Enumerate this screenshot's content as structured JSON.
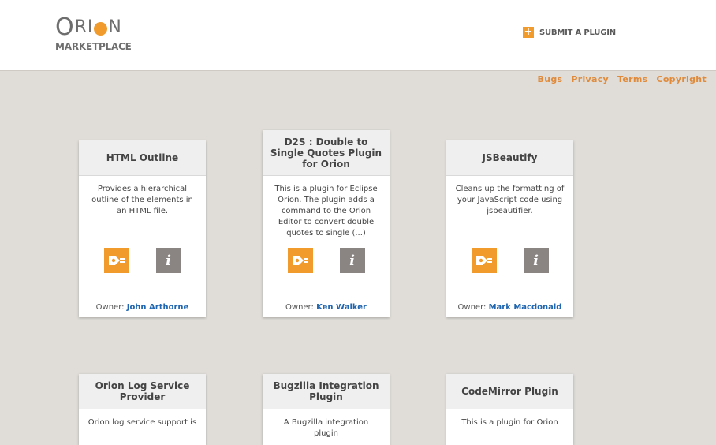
{
  "header": {
    "logo_main_o": "O",
    "logo_main_ri": "RI",
    "logo_main_n": "N",
    "logo_sub": "MARKETPLACE",
    "submit_icon": "plus-icon",
    "submit_label": "SUBMIT A PLUGIN"
  },
  "links": [
    "Bugs",
    "Privacy",
    "Terms",
    "Copyright"
  ],
  "colors": {
    "accent": "#f19b2c",
    "link": "#e08a3a",
    "owner_link": "#2166b0",
    "background": "#e0ddd8"
  },
  "plugins": [
    {
      "title": "HTML Outline",
      "description": "Provides a hierarchical outline of the elements in an HTML file.",
      "owner_label": "Owner:",
      "owner": "John Arthorne"
    },
    {
      "title": "D2S : Double to Single Quotes Plugin for Orion",
      "description": "This is a plugin for Eclipse Orion. The plugin adds a command to the Orion Editor to convert double quotes to single (...)",
      "owner_label": "Owner:",
      "owner": "Ken Walker"
    },
    {
      "title": "JSBeautify",
      "description": "Cleans up the formatting of your JavaScript code using jsbeautifier.",
      "owner_label": "Owner:",
      "owner": "Mark Macdonald"
    },
    {
      "title": "Orion Log Service Provider",
      "description": "Orion log service support is"
    },
    {
      "title": "Bugzilla Integration Plugin",
      "description": "A Bugzilla integration plugin"
    },
    {
      "title": "CodeMirror Plugin",
      "description": "This is a plugin for Orion"
    }
  ],
  "install_icon": "plug-icon",
  "info_icon": "info-icon",
  "info_glyph": "i"
}
